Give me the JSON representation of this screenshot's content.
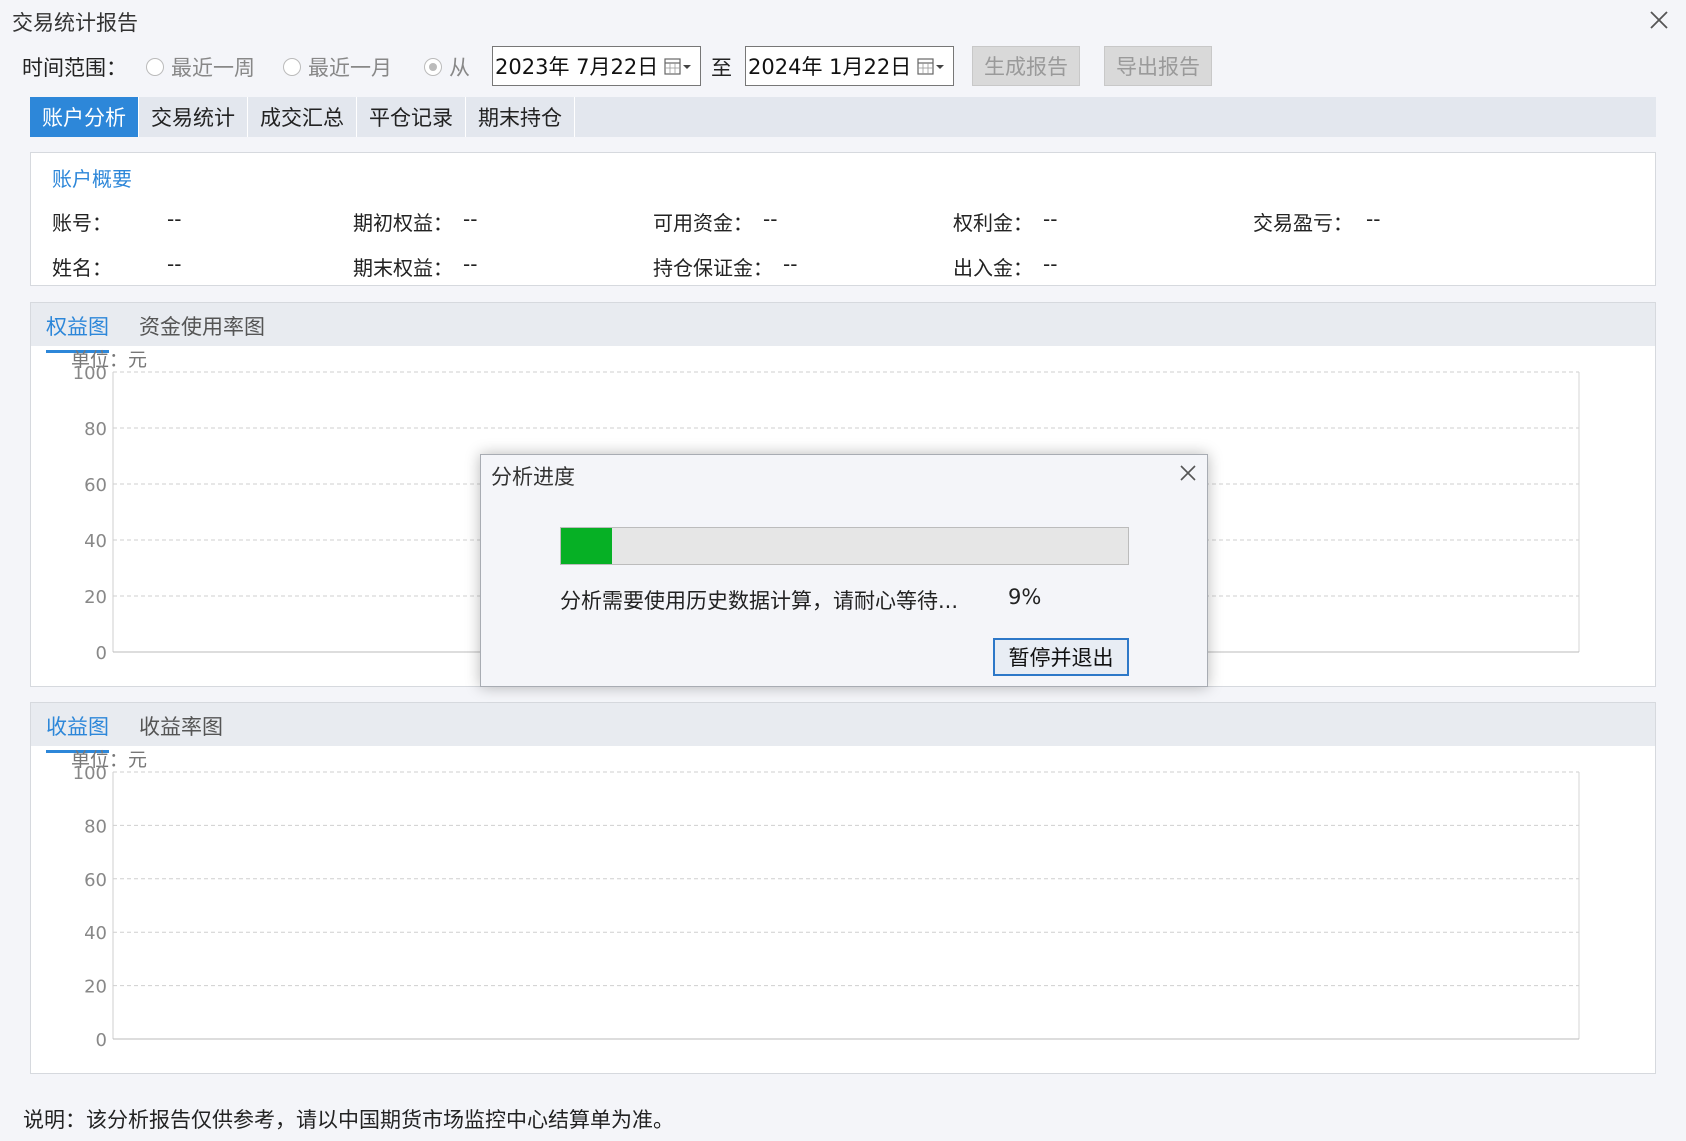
{
  "window": {
    "title": "交易统计报告",
    "close_icon": "close-icon"
  },
  "toolbar": {
    "range_label": "时间范围：",
    "options": [
      {
        "label": "最近一周",
        "checked": false
      },
      {
        "label": "最近一月",
        "checked": false
      },
      {
        "label": "从",
        "checked": true
      }
    ],
    "start_date": "2023年 7月22日",
    "to_label": "至",
    "end_date": "2024年 1月22日",
    "generate_button": "生成报告",
    "export_button": "导出报告"
  },
  "main_tabs": [
    {
      "label": "账户分析",
      "active": true
    },
    {
      "label": "交易统计",
      "active": false
    },
    {
      "label": "成交汇总",
      "active": false
    },
    {
      "label": "平仓记录",
      "active": false
    },
    {
      "label": "期末持仓",
      "active": false
    }
  ],
  "summary": {
    "title": "账户概要",
    "fields": [
      {
        "label": "账号：",
        "value": "--"
      },
      {
        "label": "期初权益：",
        "value": "--"
      },
      {
        "label": "可用资金：",
        "value": "--"
      },
      {
        "label": "权利金：",
        "value": "--"
      },
      {
        "label": "交易盈亏：",
        "value": "--"
      },
      {
        "label": "姓名：",
        "value": "--"
      },
      {
        "label": "期末权益：",
        "value": "--"
      },
      {
        "label": "持仓保证金：",
        "value": "--"
      },
      {
        "label": "出入金：",
        "value": "--"
      }
    ]
  },
  "equity_panel": {
    "tabs": [
      "权益图",
      "资金使用率图"
    ],
    "active_tab": 0
  },
  "profit_panel": {
    "tabs": [
      "收益图",
      "收益率图"
    ],
    "active_tab": 0
  },
  "chart_data": [
    {
      "type": "line",
      "unit_label": "单位：元",
      "ylim": [
        0,
        100
      ],
      "yticks": [
        "100",
        "80",
        "60",
        "40",
        "20",
        "0"
      ],
      "series": [],
      "grid": true
    },
    {
      "type": "line",
      "unit_label": "单位：元",
      "ylim": [
        0,
        100
      ],
      "yticks": [
        "100",
        "80",
        "60",
        "40",
        "20",
        "0"
      ],
      "series": [],
      "grid": true
    }
  ],
  "footer": {
    "note": "说明：该分析报告仅供参考，请以中国期货市场监控中心结算单为准。"
  },
  "dialog": {
    "title": "分析进度",
    "progress": 0.09,
    "message": "分析需要使用历史数据计算，请耐心等待...",
    "percent_text": "9%",
    "button": "暂停并退出"
  },
  "colors": {
    "accent": "#2d87d9",
    "progress": "#06b025",
    "tab_bar": "#e3e7ee"
  }
}
